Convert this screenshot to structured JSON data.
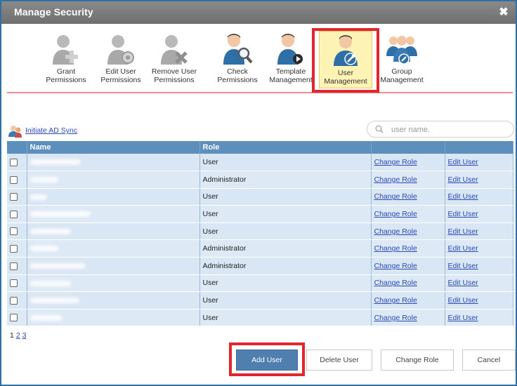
{
  "window": {
    "title": "Manage Security"
  },
  "toolbar": {
    "items": [
      {
        "label": "Grant\nPermissions",
        "icon": "user-plus-icon"
      },
      {
        "label": "Edit User\nPermissions",
        "icon": "user-gear-icon"
      },
      {
        "label": "Remove User\nPermissions",
        "icon": "user-remove-icon"
      },
      {
        "label": "Check\nPermissions",
        "icon": "user-search-icon"
      },
      {
        "label": "Template\nManagement",
        "icon": "user-template-icon"
      },
      {
        "label": "User\nManagement",
        "icon": "user-wrench-icon",
        "active": true
      },
      {
        "label": "Group\nManagement",
        "icon": "group-wrench-icon"
      }
    ]
  },
  "ad_sync": {
    "label": "Initiate AD Sync"
  },
  "search": {
    "placeholder": "user name."
  },
  "table": {
    "columns": [
      "",
      "Name",
      "Role",
      "",
      ""
    ],
    "rows": [
      {
        "role": "User",
        "change": "Change Role",
        "edit": "Edit User"
      },
      {
        "role": "Administrator",
        "change": "Change Role",
        "edit": "Edit User"
      },
      {
        "role": "User",
        "change": "Change Role",
        "edit": "Edit User"
      },
      {
        "role": "User",
        "change": "Change Role",
        "edit": "Edit User"
      },
      {
        "role": "User",
        "change": "Change Role",
        "edit": "Edit User"
      },
      {
        "role": "Administrator",
        "change": "Change Role",
        "edit": "Edit User"
      },
      {
        "role": "Administrator",
        "change": "Change Role",
        "edit": "Edit User"
      },
      {
        "role": "User",
        "change": "Change Role",
        "edit": "Edit User"
      },
      {
        "role": "User",
        "change": "Change Role",
        "edit": "Edit User"
      },
      {
        "role": "User",
        "change": "Change Role",
        "edit": "Edit User"
      }
    ]
  },
  "pager": {
    "pages": [
      "1",
      "2",
      "3"
    ]
  },
  "footer": {
    "add_user": "Add User",
    "delete_user": "Delete User",
    "change_role": "Change Role",
    "cancel": "Cancel"
  },
  "colors": {
    "title_bar": "#7a7a7a",
    "header_row": "#5c8fbc",
    "row_bg": "#dde9f5",
    "primary_button": "#4e7fae",
    "highlight": "#e3262e"
  }
}
